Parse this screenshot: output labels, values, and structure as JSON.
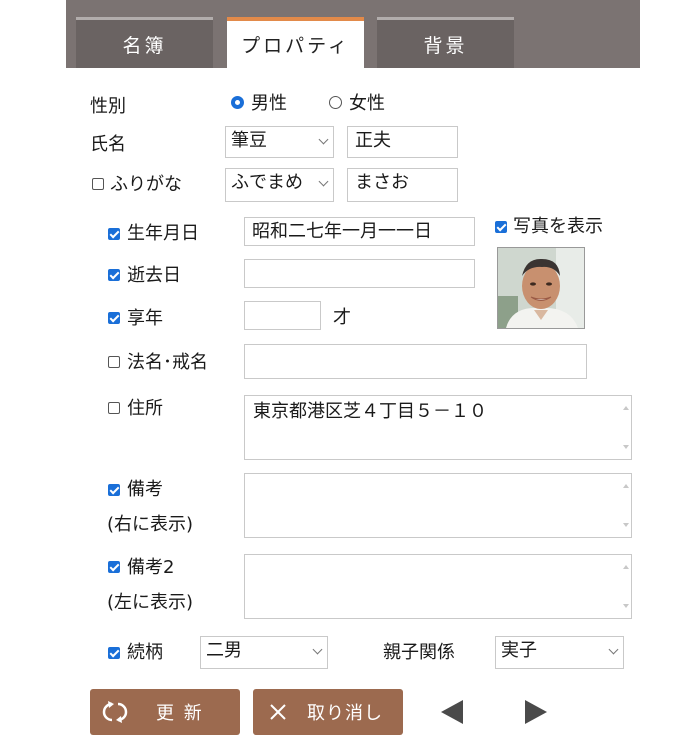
{
  "tabs": [
    {
      "label": "名簿",
      "active": false
    },
    {
      "label": "プロパティ",
      "active": true
    },
    {
      "label": "背景",
      "active": false
    }
  ],
  "gender": {
    "label": "性別",
    "options": [
      "男性",
      "女性"
    ],
    "selected": "男性"
  },
  "name": {
    "label": "氏名",
    "surname": "筆豆",
    "given": "正夫"
  },
  "furigana": {
    "label": "ふりがな",
    "checked": false,
    "surname": "ふでまめ",
    "given": "まさお"
  },
  "birthdate": {
    "label": "生年月日",
    "checked": true,
    "value": "昭和二七年一月一一日"
  },
  "show_photo": {
    "label": "写真を表示",
    "checked": true
  },
  "death_date": {
    "label": "逝去日",
    "checked": true,
    "value": ""
  },
  "age": {
    "label": "享年",
    "checked": true,
    "value": "",
    "unit": "才"
  },
  "posthumous_name": {
    "label": "法名･戒名",
    "checked": false,
    "value": ""
  },
  "address": {
    "label": "住所",
    "checked": false,
    "value": "東京都港区芝４丁目５－１０"
  },
  "notes": {
    "label": "備考",
    "sublabel": "(右に表示)",
    "checked": true,
    "value": ""
  },
  "notes2": {
    "label": "備考2",
    "sublabel": "(左に表示)",
    "checked": true,
    "value": ""
  },
  "relation": {
    "label": "続柄",
    "checked": true,
    "value": "二男",
    "parent_label": "親子関係",
    "parent_value": "実子"
  },
  "buttons": {
    "update": "更 新",
    "cancel": "取り消し"
  },
  "colors": {
    "accent": "#e28a4a",
    "check": "#1a6fd8",
    "button": "#9c6a4f",
    "tabbar": "#7b7372"
  }
}
